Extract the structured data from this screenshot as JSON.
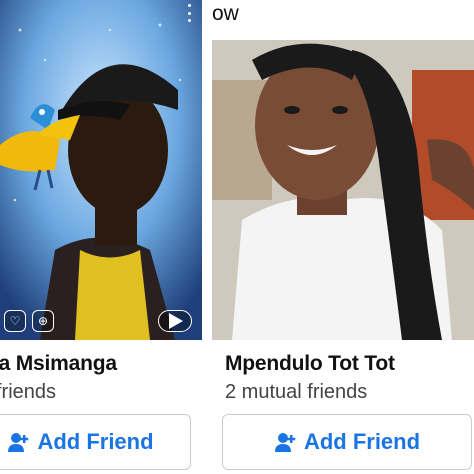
{
  "header": {
    "see_all_suffix": "ow"
  },
  "cards": [
    {
      "name": "ga Msimanga",
      "mutual": "l friends",
      "button": "Add Friend"
    },
    {
      "name": "Mpendulo Tot Tot",
      "mutual": "2 mutual friends",
      "button": "Add Friend"
    }
  ],
  "colors": {
    "accent": "#1b74e4",
    "button_border": "#c9ccd1"
  },
  "icons": {
    "menu": "more-vertical-icon",
    "like": "heart-icon",
    "share": "share-icon",
    "play": "play-icon",
    "add_friend": "user-plus-icon"
  }
}
